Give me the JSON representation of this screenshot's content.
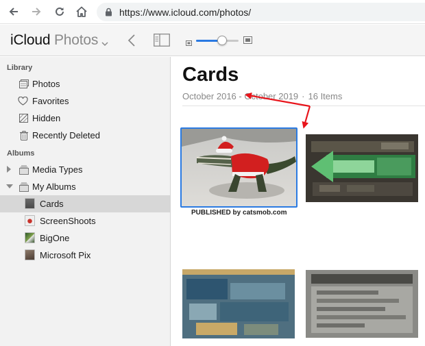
{
  "browser": {
    "url": "https://www.icloud.com/photos/",
    "icons": [
      "back-arrow-icon",
      "forward-arrow-icon",
      "reload-icon",
      "home-icon",
      "lock-icon"
    ]
  },
  "header": {
    "app_name": "iCloud",
    "section_name": "Photos",
    "zoom_level": 0.62
  },
  "sidebar": {
    "library_label": "Library",
    "library_items": [
      {
        "label": "Photos",
        "icon": "photos-icon"
      },
      {
        "label": "Favorites",
        "icon": "heart-icon"
      },
      {
        "label": "Hidden",
        "icon": "hidden-icon"
      },
      {
        "label": "Recently Deleted",
        "icon": "trash-icon"
      }
    ],
    "albums_label": "Albums",
    "album_groups": [
      {
        "label": "Media Types",
        "icon": "album-stack-icon",
        "expanded": false
      },
      {
        "label": "My Albums",
        "icon": "album-stack-icon",
        "expanded": true
      }
    ],
    "my_albums": [
      {
        "label": "Cards",
        "selected": true
      },
      {
        "label": "ScreenShoots",
        "selected": false
      },
      {
        "label": "BigOne",
        "selected": false
      },
      {
        "label": "Microsoft Pix",
        "selected": false
      }
    ]
  },
  "main": {
    "album_title": "Cards",
    "date_start": "October 2016",
    "date_sep": "-",
    "date_end": "October 2019",
    "item_sep": "·",
    "item_count": "16 Items",
    "photo_caption": "PUBLISHED by catsmob.com"
  },
  "colors": {
    "accent": "#2a7ae2",
    "annotation": "#e8141b",
    "sidebar_bg": "#f2f2f2",
    "selected_row": "#d7d7d7"
  }
}
